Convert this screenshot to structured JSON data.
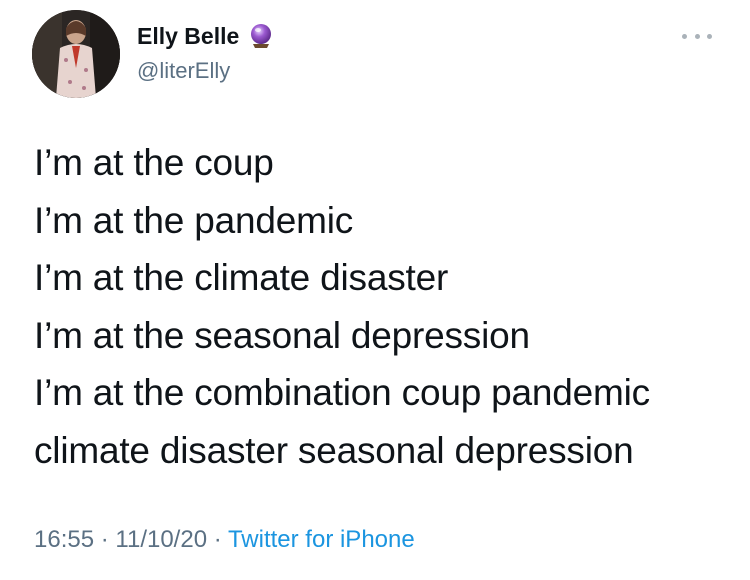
{
  "author": {
    "display_name": "Elly Belle",
    "handle": "@literElly",
    "badge_icon": "crystal-ball-icon",
    "avatar_icon": "profile-photo"
  },
  "menu": {
    "icon": "more-options-icon"
  },
  "tweet": {
    "lines": [
      "I’m at the coup",
      "I’m at the pandemic",
      "I’m at the climate disaster",
      "I’m at the seasonal depression",
      "I’m at the combination coup pandemic",
      "climate disaster seasonal depression"
    ]
  },
  "meta": {
    "time": "16:55",
    "separator": "·",
    "date": "11/10/20",
    "source": "Twitter for iPhone"
  },
  "colors": {
    "text": "#0f1419",
    "secondary": "#5b7083",
    "link": "#1b95e0"
  }
}
